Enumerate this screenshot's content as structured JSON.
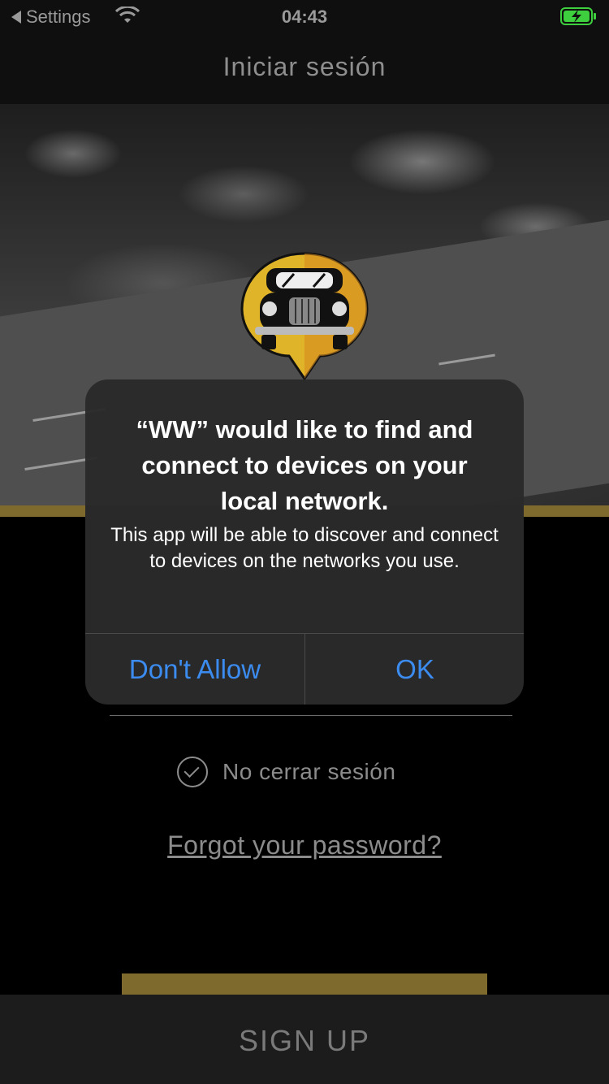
{
  "status_bar": {
    "back_label": "Settings",
    "time": "04:43"
  },
  "nav": {
    "title": "Iniciar sesión"
  },
  "form": {
    "remember_label": "No cerrar sesión",
    "forgot_link": "Forgot your password?"
  },
  "footer": {
    "signup_label": "SIGN UP"
  },
  "alert": {
    "title": "“WW” would like to find and connect to devices on your local network.",
    "message": "This app will be able to discover and connect to devices on the networks you use.",
    "deny_label": "Don't Allow",
    "ok_label": "OK"
  },
  "colors": {
    "accent_gold": "#7d6a2c",
    "alert_button_blue": "#3c8cf0",
    "battery_green": "#3ecf3e"
  }
}
